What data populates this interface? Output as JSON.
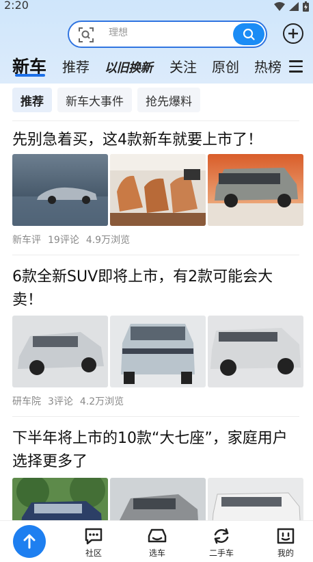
{
  "status_bar": {
    "time": "2:20"
  },
  "search": {
    "placeholder": "理想"
  },
  "channels": {
    "active": "新车",
    "items": [
      "推荐",
      "以旧换新",
      "关注",
      "原创",
      "热榜"
    ]
  },
  "sub_tabs": [
    "推荐",
    "新车大事件",
    "抢先爆料"
  ],
  "articles": [
    {
      "title": "先别急着买，这4款新车就要上市了！",
      "source": "新车评",
      "comments": "19评论",
      "views": "4.9万浏览"
    },
    {
      "title": "6款全新SUV即将上市，有2款可能会大卖！",
      "source": "研车院",
      "comments": "3评论",
      "views": "4.2万浏览"
    },
    {
      "title": "下半年将上市的10款“大七座”，家庭用户选择更多了"
    }
  ],
  "bottom_nav": {
    "items": [
      "社区",
      "选车",
      "二手车",
      "我的"
    ]
  },
  "colors": {
    "accent": "#1b8cf5",
    "tab_underline": "#1b6fe8",
    "header_bg": "#d6e9fb"
  }
}
